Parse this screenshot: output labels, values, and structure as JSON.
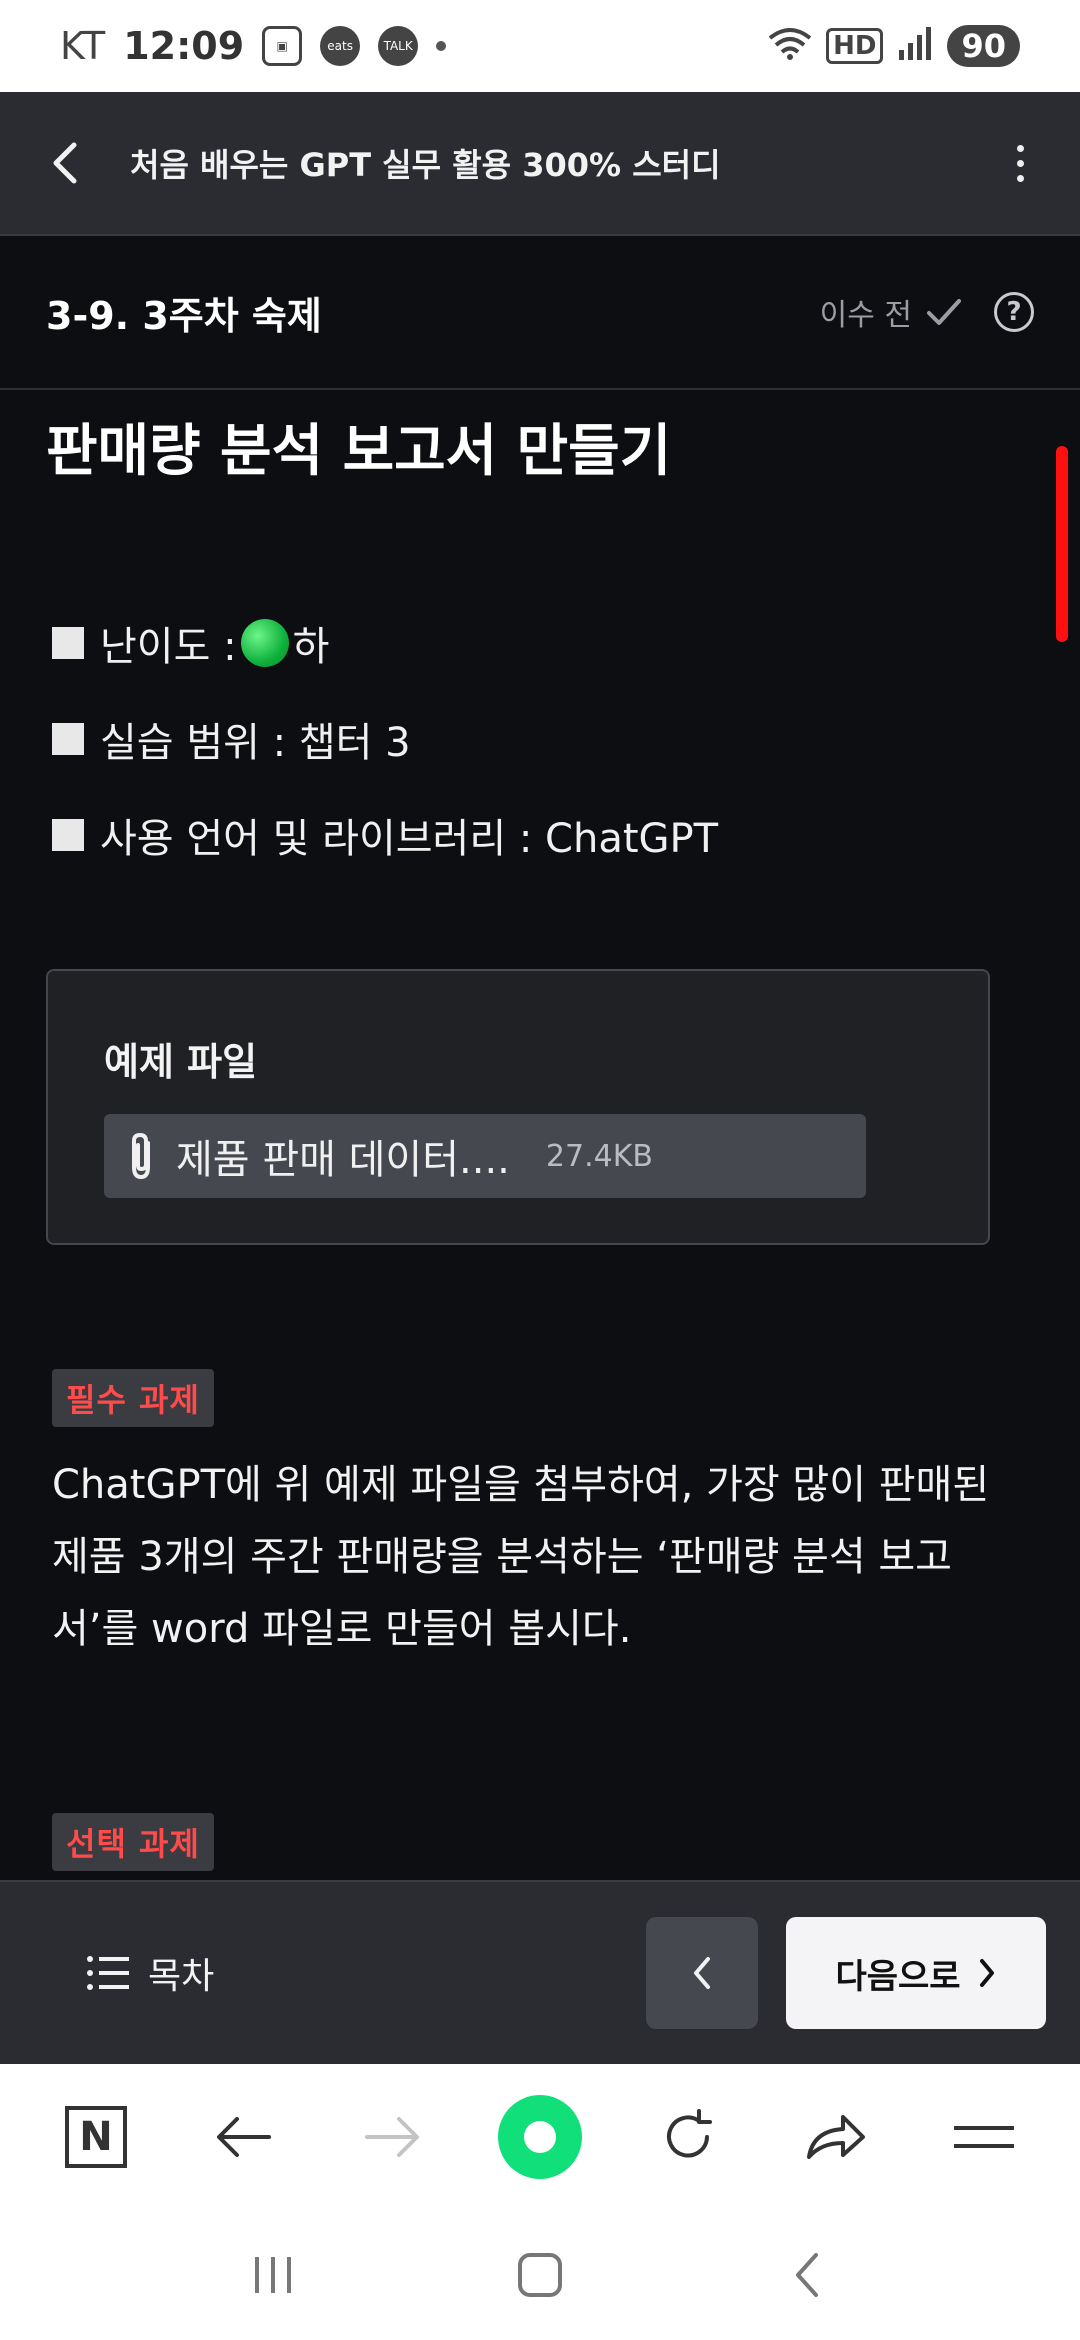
{
  "status_bar": {
    "carrier": "KT",
    "time": "12:09",
    "app_icons": [
      "gallery-icon",
      "coupang-eats-icon",
      "kakaotalk-icon"
    ],
    "coupang_label": "eats",
    "talk_label": "TALK",
    "battery": "90",
    "hd_label": "HD"
  },
  "app_header": {
    "title": "처음 배우는 GPT 실무 활용 300% 스터디"
  },
  "lesson": {
    "title": "3-9. 3주차 숙제",
    "status": "이수 전"
  },
  "content": {
    "heading": "판매량 분석 보고서 만들기",
    "meta": [
      {
        "label": "난이도 : ",
        "suffix": "하"
      },
      {
        "label": "실습 범위 : 챕터 3"
      },
      {
        "label": "사용 언어 및 라이브러리 : ChatGPT"
      }
    ],
    "example": {
      "title": "예제 파일",
      "file_name": "제품 판매 데이터....",
      "file_size": "27.4KB"
    },
    "required_tag": "필수 과제",
    "required_text": "ChatGPT에 위 예제 파일을 첨부하여, 가장 많이 판매된 제품 3개의 주간 판매량을 분석하는 ‘판매량 분석 보고서’를 word 파일로 만들어 봅시다.",
    "optional_tag": "선택 과제"
  },
  "bottom_nav": {
    "toc_label": "목차",
    "next_label": "다음으로"
  },
  "colors": {
    "accent_red": "#ff4b4b",
    "scroll_indicator": "#ff1010",
    "browser_green": "#11e07a",
    "difficulty_green": "#0fb13c"
  }
}
